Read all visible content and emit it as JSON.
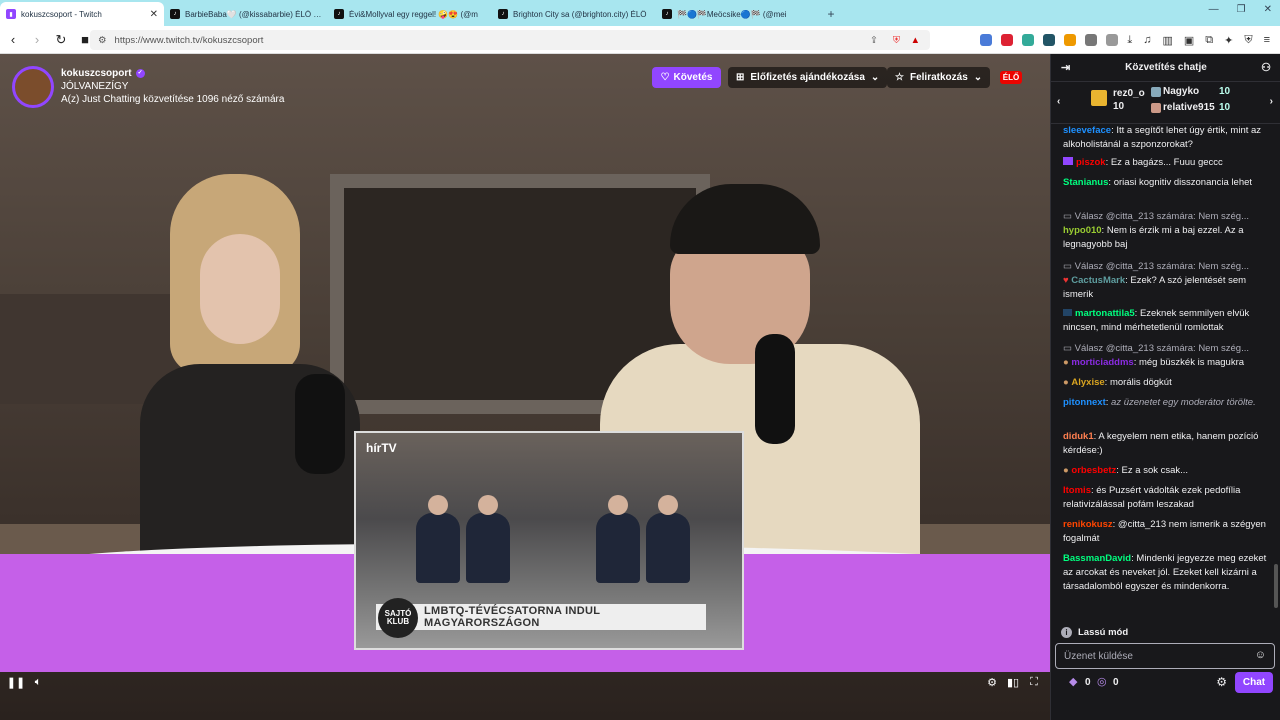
{
  "browser": {
    "tabs": [
      {
        "label": "kokuszcsoport - Twitch",
        "active": true
      },
      {
        "label": "BarbieBaba🤍 (@kissabarbie) ÉLŐ ad",
        "active": false
      },
      {
        "label": "Évi&Mollyval egy reggel! 🤪😍 (@m",
        "active": false
      },
      {
        "label": "Brighton City sa (@brighton.city) ÉLŐ",
        "active": false
      },
      {
        "label": "🏁🔵🏁Meöcsike🔵🏁 (@mei",
        "active": false
      }
    ],
    "new_tab": "+",
    "url": "https://www.twitch.tv/kokuszcsoport"
  },
  "stream": {
    "channel": "kokuszcsoport",
    "title": "JÓLVANEZÍGY",
    "subtitle": "A(z) Just Chatting közvetítése 1096 néző számára",
    "follow_label": "Követés",
    "gift_label": "Előfizetés ajándékozása",
    "subscribe_label": "Feliratkozás",
    "live_label": "ÉLŐ"
  },
  "inset": {
    "logo": "hírTV",
    "chyron": "LMBTQ-TÉVÉCSATORNA INDUL MAGYARORSZÁGON",
    "chyron_logo": "SAJTÓ KLUB"
  },
  "chat": {
    "title": "Közvetítés chatje",
    "leaderboard": [
      {
        "name": "rez0_o",
        "count": "10"
      },
      {
        "name": "Nagyko",
        "count": "10"
      },
      {
        "name": "relative915",
        "count": "10"
      }
    ],
    "messages": [
      {
        "user": "sleeveface",
        "color": "#1e90ff",
        "text": "Itt a segítőt lehet úgy értik, mint az alkoholistánál a szponzorokat?",
        "reply": ""
      },
      {
        "user": "piszok",
        "color": "#ff0000",
        "text": "Ez a bagázs... Fuuu geccc",
        "reply": ""
      },
      {
        "user": "Stanianus",
        "color": "#00ff7f",
        "text": "oriasi kognitiv disszonancia lehet",
        "reply": ""
      },
      {
        "user": "hypo010",
        "color": "#9acd32",
        "text": "Nem is érzik mi a baj ezzel. Az a legnagyobb baj",
        "reply": "Válasz @citta_213 számára: Nem szég..."
      },
      {
        "user": "CactusMark",
        "color": "#5f9ea0",
        "text": "Ezek? A szó jelentését sem ismerik",
        "reply": "Válasz @citta_213 számára: Nem szég..."
      },
      {
        "user": "martonattila5",
        "color": "#00ff7f",
        "text": "Ezeknek semmilyen elvük nincsen, mind mérhetetlenül romlottak",
        "reply": ""
      },
      {
        "user": "morticiaddms",
        "color": "#8a2be2",
        "text": "még büszkék is magukra",
        "reply": "Válasz @citta_213 számára: Nem szég..."
      },
      {
        "user": "Alyxise",
        "color": "#daa520",
        "text": "morális dögkút",
        "reply": ""
      },
      {
        "user": "pitonnext",
        "color": "#1e90ff",
        "text": "az üzenetet egy moderátor törölte.",
        "reply": "",
        "deleted": true
      },
      {
        "user": "diduk1",
        "color": "#ff7f50",
        "text": "A kegyelem nem etika, hanem pozíció kérdése:)",
        "reply": ""
      },
      {
        "user": "orbesbetz",
        "color": "#ff0000",
        "text": "Ez a sok csak...",
        "reply": ""
      },
      {
        "user": "Itomis",
        "color": "#ff0000",
        "text": "és Puzsért vádolták ezek pedofília relativizálással pofám leszakad",
        "reply": ""
      },
      {
        "user": "renikokusz",
        "color": "#ff4500",
        "text": "@citta_213 nem ismerik a szégyen fogalmát",
        "reply": ""
      },
      {
        "user": "BassmanDavid",
        "color": "#00ff7f",
        "text": "Mindenki jegyezze meg ezeket az arcokat és neveket jól. Ezeket kell kizárni a társadalomból egyszer és mindenkorra.",
        "reply": ""
      }
    ],
    "slow_mode": "Lassú mód",
    "input_placeholder": "Üzenet küldése",
    "points_a": "0",
    "points_b": "0",
    "send_label": "Chat"
  }
}
